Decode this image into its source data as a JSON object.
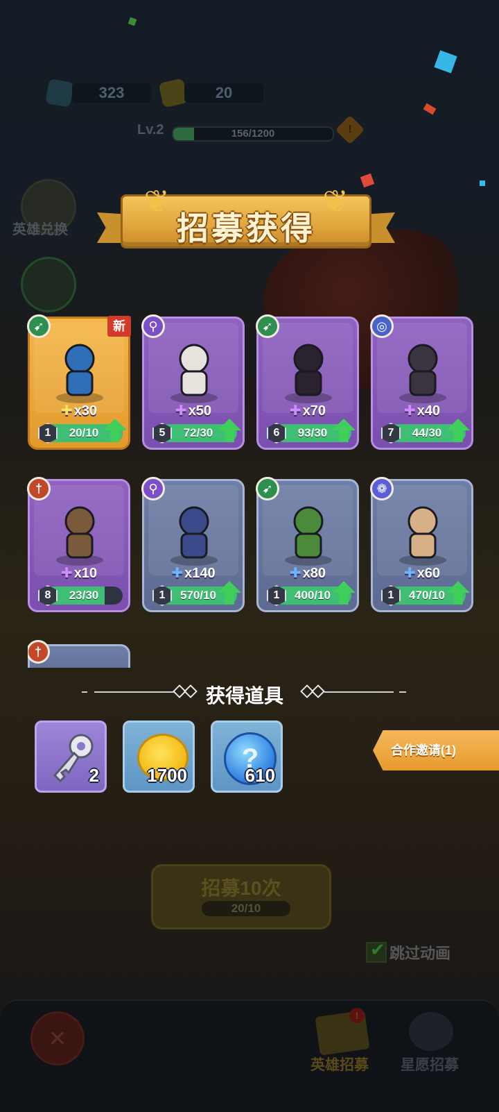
{
  "resources": {
    "gems": "323",
    "tickets": "20"
  },
  "player": {
    "level": "Lv.2",
    "xp": "156/1200",
    "xp_fraction": 0.13
  },
  "side": {
    "hero_exchange_label": "英雄兑换"
  },
  "header": {
    "title": "招募获得"
  },
  "heroes": [
    {
      "name_slot": "hero-1",
      "rarity": "gold",
      "class_icon": "archer-icon",
      "is_new": true,
      "new_label": "新",
      "shards": "x30",
      "level": "1",
      "progress": "20/10",
      "progress_fraction": 1.0,
      "upgradable": true
    },
    {
      "name_slot": "hero-2",
      "rarity": "purple",
      "class_icon": "mage-staff-icon",
      "is_new": false,
      "shards": "x50",
      "level": "5",
      "progress": "72/30",
      "progress_fraction": 1.0,
      "upgradable": true
    },
    {
      "name_slot": "hero-3",
      "rarity": "purple",
      "class_icon": "archer-icon",
      "is_new": false,
      "shards": "x70",
      "level": "6",
      "progress": "93/30",
      "progress_fraction": 1.0,
      "upgradable": true
    },
    {
      "name_slot": "hero-4",
      "rarity": "purple",
      "class_icon": "spirit-swirl-icon",
      "is_new": false,
      "shards": "x40",
      "level": "7",
      "progress": "44/30",
      "progress_fraction": 1.0,
      "upgradable": true
    },
    {
      "name_slot": "hero-5",
      "rarity": "purple",
      "class_icon": "warrior-sword-icon",
      "is_new": false,
      "shards": "x10",
      "level": "8",
      "progress": "23/30",
      "progress_fraction": 0.77,
      "upgradable": false
    },
    {
      "name_slot": "hero-6",
      "rarity": "blue",
      "class_icon": "mage-staff-icon",
      "is_new": false,
      "shards": "x140",
      "level": "1",
      "progress": "570/10",
      "progress_fraction": 1.0,
      "upgradable": true
    },
    {
      "name_slot": "hero-7",
      "rarity": "blue",
      "class_icon": "archer-icon",
      "is_new": false,
      "shards": "x80",
      "level": "1",
      "progress": "400/10",
      "progress_fraction": 1.0,
      "upgradable": true
    },
    {
      "name_slot": "hero-8",
      "rarity": "blue",
      "class_icon": "beast-paw-icon",
      "is_new": false,
      "shards": "x60",
      "level": "1",
      "progress": "470/10",
      "progress_fraction": 1.0,
      "upgradable": true
    }
  ],
  "partial_card": {
    "class_icon": "warrior-sword-icon"
  },
  "items_section": {
    "title": "获得道具",
    "items": [
      {
        "icon": "key-icon",
        "count": "2"
      },
      {
        "icon": "gold-coin-icon",
        "count": "1700"
      },
      {
        "icon": "mystery-orb-icon",
        "count": "610",
        "glyph": "?"
      }
    ]
  },
  "coop_button": {
    "label": "合作邀请(1)"
  },
  "recruit": {
    "label": "招募10次",
    "count": "20/10"
  },
  "skip_animation": {
    "label": "跳过动画",
    "checked": true
  },
  "bottom_nav": {
    "tab_hero_recruit": "英雄招募",
    "tab_star_recruit": "星愿招募"
  },
  "colors": {
    "gold_card": "#e39a2c",
    "purple_card": "#7a4fae",
    "blue_card": "#5d6b92",
    "progress_green": "#3fbf74",
    "accent_orange": "#e79a2e"
  }
}
